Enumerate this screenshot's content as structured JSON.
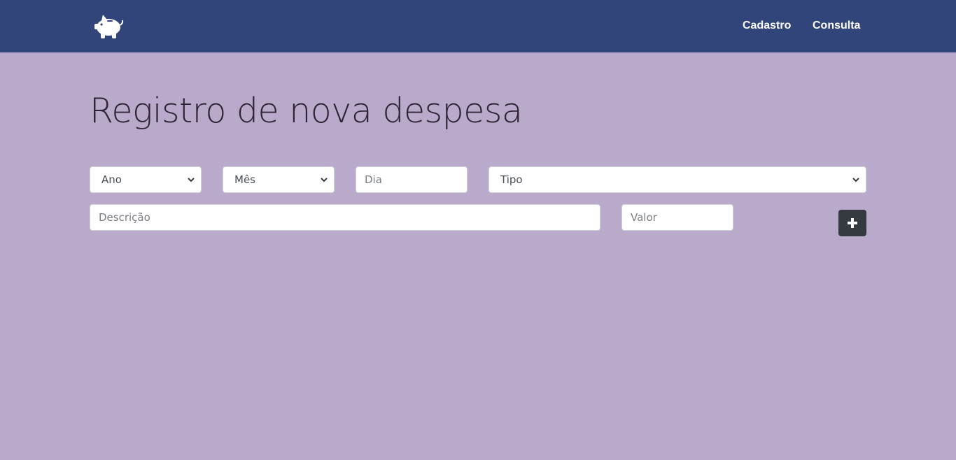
{
  "navbar": {
    "brand_icon": "piggy-bank-icon",
    "links": [
      {
        "label": "Cadastro"
      },
      {
        "label": "Consulta"
      }
    ],
    "background_color": "#32457a"
  },
  "page": {
    "title": "Registro de nova despesa",
    "background_color": "#b9aacb"
  },
  "form": {
    "ano": {
      "selected": "Ano"
    },
    "mes": {
      "selected": "Mês"
    },
    "dia": {
      "placeholder": "Dia",
      "value": ""
    },
    "tipo": {
      "selected": "Tipo"
    },
    "descricao": {
      "placeholder": "Descrição",
      "value": ""
    },
    "valor": {
      "placeholder": "Valor",
      "value": ""
    },
    "add_button": {
      "icon": "plus-icon",
      "color": "#343a40"
    }
  }
}
